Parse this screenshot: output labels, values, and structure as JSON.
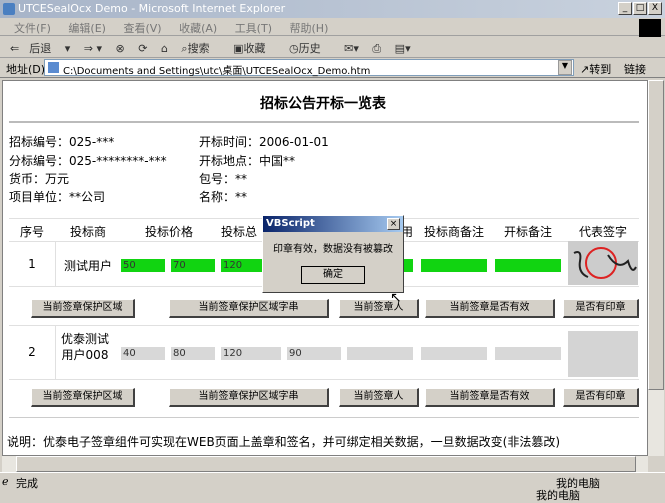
{
  "window": {
    "title": "UTCESealOcx Demo - Microsoft Internet Explorer"
  },
  "menu": [
    "文件(F)",
    "编辑(E)",
    "查看(V)",
    "收藏(A)",
    "工具(T)",
    "帮助(H)"
  ],
  "toolbar": {
    "back": "后退",
    "search": "搜索",
    "favorites": "收藏",
    "history": "历史"
  },
  "address": {
    "label": "地址(D)",
    "value": "C:\\Documents and Settings\\utc\\桌面\\UTCESealOcx_Demo.htm",
    "go": "转到",
    "links": "链接"
  },
  "page": {
    "title": "招标公告开标一览表",
    "info": [
      {
        "label": "招标编号：",
        "value": "025-***"
      },
      {
        "label": "开标时间：",
        "value": "2006-01-01"
      },
      {
        "label": "分标编号：",
        "value": "025-********-***"
      },
      {
        "label": "开标地点：",
        "value": "中国**"
      },
      {
        "label": "货币：",
        "value": "万元"
      },
      {
        "label": "包号：",
        "value": "**"
      },
      {
        "label": "项目单位：",
        "value": "**公司"
      },
      {
        "label": "名称：",
        "value": "**"
      }
    ],
    "headers": [
      "序号",
      "投标商",
      "投标价格",
      "投标总",
      "用",
      "投标商备注",
      "开标备注",
      "代表签字"
    ],
    "rows": [
      {
        "no": "1",
        "bidder": "测试用户",
        "values": [
          "50",
          "70",
          "120",
          "",
          "",
          "",
          ""
        ],
        "signed": true
      },
      {
        "no": "2",
        "bidder": "优泰测试用户008",
        "values": [
          "40",
          "80",
          "120",
          "90",
          "",
          "",
          ""
        ],
        "signed": false
      }
    ],
    "buttons": [
      "当前签章保护区域",
      "当前签章保护区域字串",
      "当前签章人",
      "当前签章是否有效",
      "是否有印章"
    ],
    "note": "说明：优泰电子签章组件可实现在WEB页面上盖章和签名，并可绑定相关数据，一旦数据改变(非法篡改)"
  },
  "dialog": {
    "title": "VBScript",
    "message": "印章有效，数据没有被篡改",
    "ok": "确定"
  },
  "status": {
    "text": "完成",
    "zone": "我的电脑"
  },
  "colors": {
    "filled": "#11d411",
    "empty": "#d8d8d8"
  }
}
